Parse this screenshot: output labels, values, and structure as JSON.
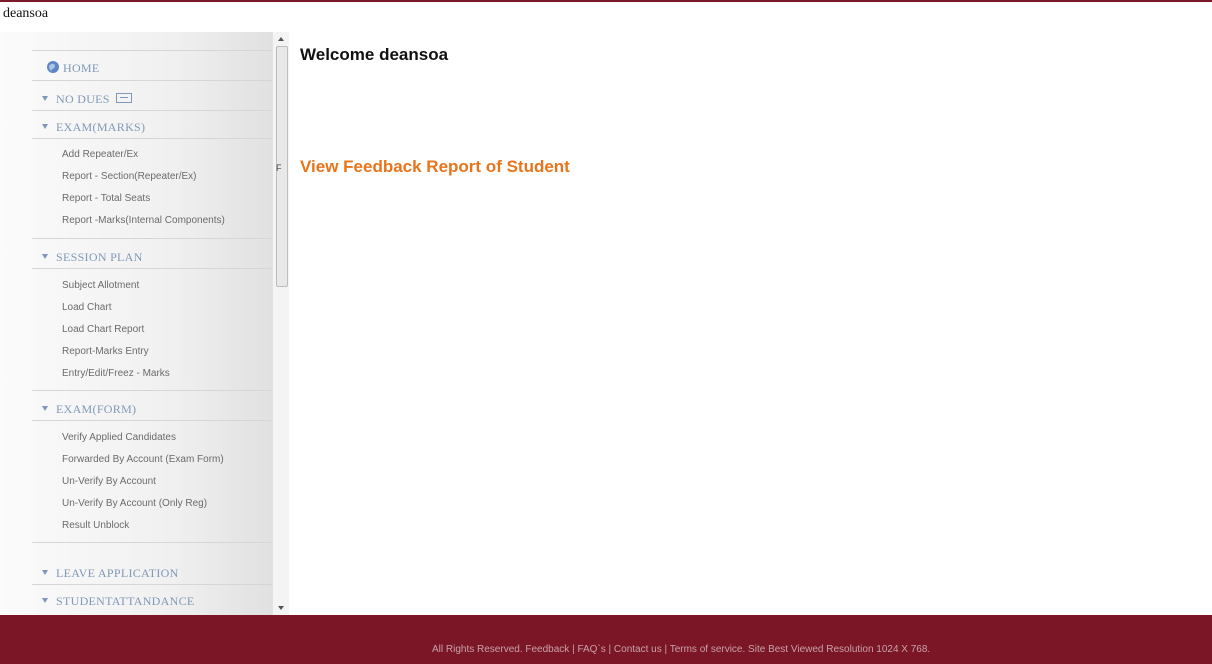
{
  "user": {
    "name": "deansoa"
  },
  "sidebar": {
    "home_label": "HOME",
    "sections": [
      {
        "title": "NO DUES",
        "items": []
      },
      {
        "title": "EXAM(MARKS)",
        "items": [
          "Add Repeater/Ex",
          "Report - Section(Repeater/Ex)",
          "Report - Total Seats",
          "Report -Marks(Internal Components)"
        ]
      },
      {
        "title": "SESSION PLAN",
        "items": [
          "Subject Allotment",
          "Load Chart",
          "Load Chart Report",
          "Report-Marks Entry",
          "Entry/Edit/Freez - Marks"
        ]
      },
      {
        "title": "EXAM(FORM)",
        "items": [
          "Verify Applied Candidates",
          "Forwarded By Account (Exam Form)",
          "Un-Verify By Account",
          "Un-Verify By Account (Only Reg)",
          "Result Unblock"
        ]
      },
      {
        "title": "LEAVE APPLICATION",
        "items": []
      },
      {
        "title": "STUDENTATTANDANCE",
        "items": []
      }
    ],
    "scroll_marker": "F"
  },
  "main": {
    "welcome_prefix": "Welcome",
    "feedback_link": "View Feedback Report of Student"
  },
  "footer": {
    "text": "All Rights Reserved. Feedback | FAQ`s | Contact us | Terms of service. Site Best Viewed Resolution 1024 X 768."
  },
  "colors": {
    "footer_bg": "#7a1625",
    "link_orange": "#e8741c",
    "menu_blue": "#7f98b8"
  }
}
